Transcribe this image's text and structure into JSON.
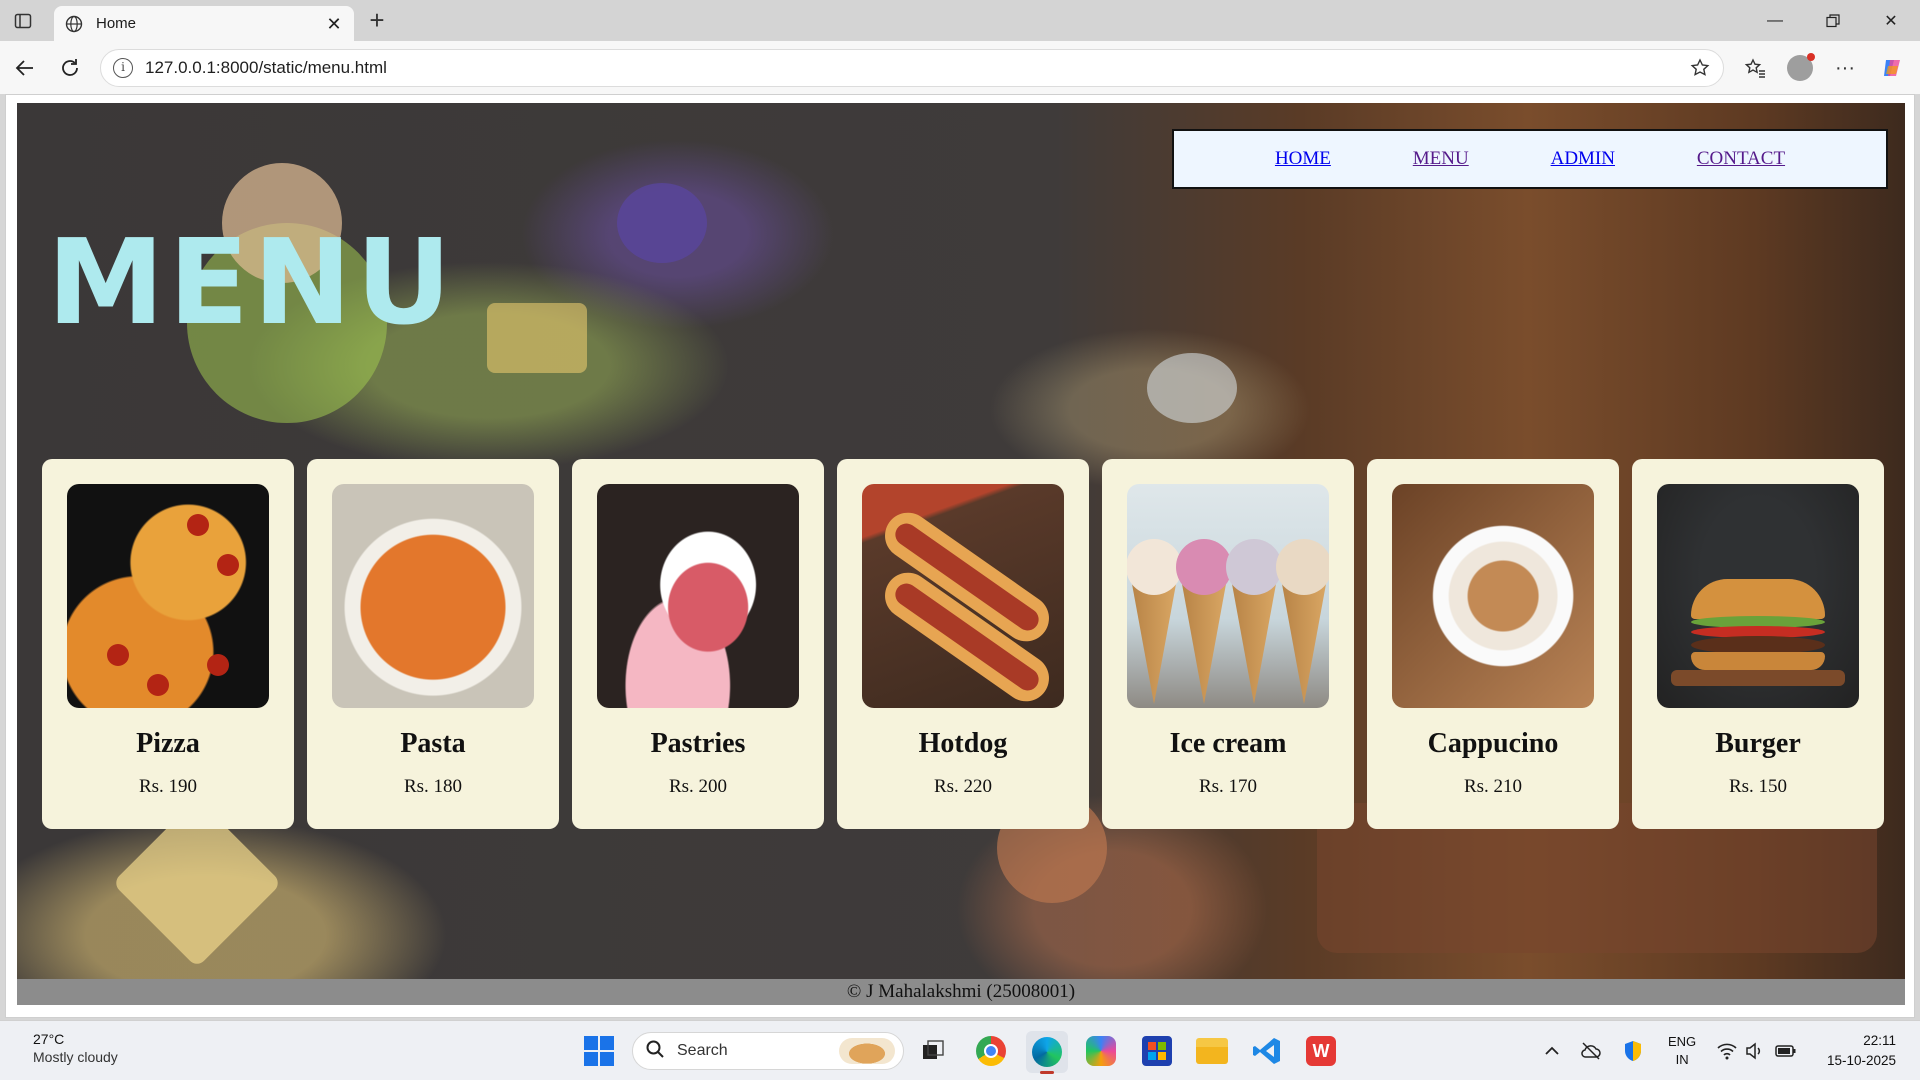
{
  "browser": {
    "tab_title": "Home",
    "url": "127.0.0.1:8000/static/menu.html"
  },
  "page": {
    "hero_title": "MENU",
    "nav": [
      {
        "label": "HOME"
      },
      {
        "label": "MENU"
      },
      {
        "label": "ADMIN"
      },
      {
        "label": "CONTACT"
      }
    ],
    "items": [
      {
        "name": "Pizza",
        "price": "Rs. 190",
        "image": "pizza-image"
      },
      {
        "name": "Pasta",
        "price": "Rs. 180",
        "image": "pasta-image"
      },
      {
        "name": "Pastries",
        "price": "Rs. 200",
        "image": "pastry-image"
      },
      {
        "name": "Hotdog",
        "price": "Rs. 220",
        "image": "hotdog-image"
      },
      {
        "name": "Ice cream",
        "price": "Rs. 170",
        "image": "ice-cream-image"
      },
      {
        "name": "Cappucino",
        "price": "Rs. 210",
        "image": "cappuccino-image"
      },
      {
        "name": "Burger",
        "price": "Rs. 150",
        "image": "burger-image"
      }
    ],
    "footer": "© J Mahalakshmi (25008001)"
  },
  "taskbar": {
    "weather_temp": "27°C",
    "weather_desc": "Mostly cloudy",
    "search_label": "Search",
    "lang_top": "ENG",
    "lang_bottom": "IN",
    "time": "22:11",
    "date": "15-10-2025"
  },
  "colors": {
    "card_bg": "#f6f3dc",
    "hero_title": "#aeeaee",
    "footer_bg": "#8c8c8c",
    "nav_bg": "#eef6ff"
  }
}
